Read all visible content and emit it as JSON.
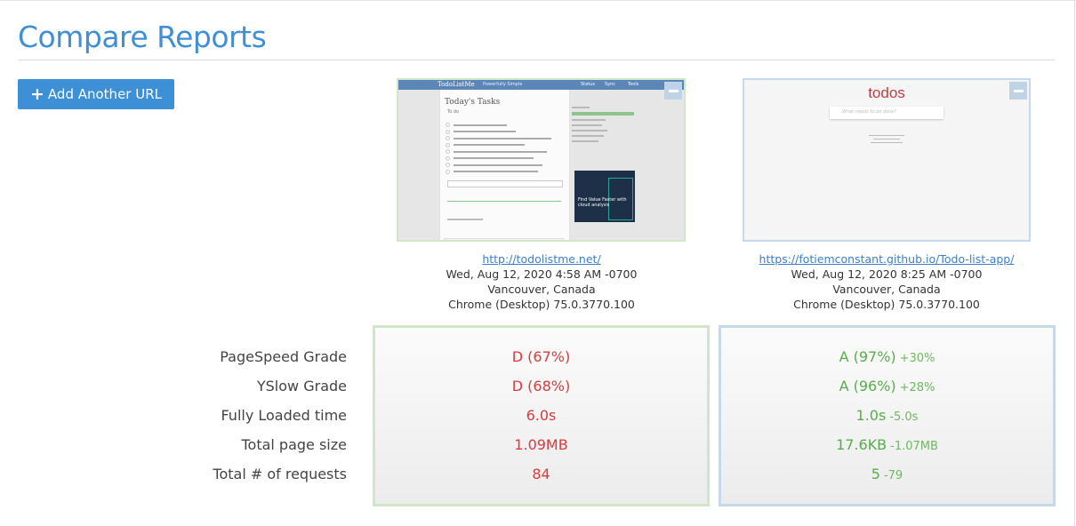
{
  "header": {
    "title": "Compare Reports",
    "add_button_label": "Add Another URL"
  },
  "colors": {
    "accent": "#3f8fd2",
    "bad": "#d63c3c",
    "good": "#58ad4a",
    "panel1_border": "#cfe6c7",
    "panel2_border": "#c7d8ea"
  },
  "reports": [
    {
      "url": "http://todolistme.net/",
      "date": "Wed, Aug 12, 2020 4:58 AM -0700",
      "location": "Vancouver, Canada",
      "browser": "Chrome (Desktop) 75.0.3770.100",
      "thumbnail": {
        "logo": "TodoListMe",
        "tagline": "Powerfully Simple",
        "nav": [
          "Status",
          "Sync",
          "Tools"
        ],
        "heading": "Today's Tasks",
        "sub": "To do",
        "ad_text": "Find Value Faster with cloud analysis"
      },
      "metrics": {
        "pagespeed": "D (67%)",
        "yslow": "D (68%)",
        "fully_loaded": "6.0s",
        "page_size": "1.09MB",
        "requests": "84"
      }
    },
    {
      "url": "https://fotiemconstant.github.io/Todo-list-app/",
      "date": "Wed, Aug 12, 2020 8:25 AM -0700",
      "location": "Vancouver, Canada",
      "browser": "Chrome (Desktop) 75.0.3770.100",
      "thumbnail": {
        "title": "todos",
        "placeholder": "What needs to be done?"
      },
      "metrics": {
        "pagespeed": "A (97%)",
        "pagespeed_delta": "+30%",
        "yslow": "A (96%)",
        "yslow_delta": "+28%",
        "fully_loaded": "1.0s",
        "fully_loaded_delta": "-5.0s",
        "page_size": "17.6KB",
        "page_size_delta": "-1.07MB",
        "requests": "5",
        "requests_delta": "-79"
      }
    }
  ],
  "metric_labels": {
    "pagespeed": "PageSpeed Grade",
    "yslow": "YSlow Grade",
    "fully_loaded": "Fully Loaded time",
    "page_size": "Total page size",
    "requests": "Total # of requests"
  },
  "icons": {
    "add": "plus-icon",
    "remove": "minus-icon"
  }
}
